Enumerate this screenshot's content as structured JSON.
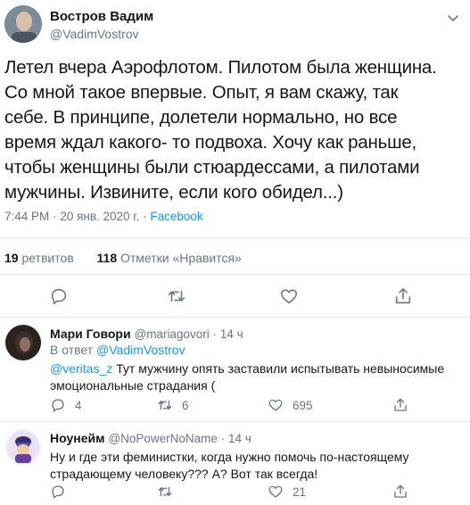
{
  "tweet": {
    "author_name": "Востров Вадим",
    "author_handle": "@VadimVostrov",
    "text": "Летел вчера Аэрофлотом. Пилотом была женщина.\nСо мной такое впервые. Опыт, я вам скажу, так\nсебе. В принципе, долетели нормально, но все\nвремя ждал какого- то подвоха. Хочу как раньше,\nчтобы женщины были стюардессами, а пилотами\nмужчины. Извините, если кого обидел...)",
    "time": "7:44 PM",
    "date": "20 янв. 2020 г.",
    "dot": "·",
    "source": "Facebook",
    "retweets_count": "19",
    "retweets_label": "ретвитов",
    "likes_count": "118",
    "likes_label": "Отметки «Нравится»"
  },
  "replies": [
    {
      "name": "Мари Говори",
      "handle": "@mariagovori",
      "time": "· 14 ч",
      "in_reply_prefix": "В ответ",
      "in_reply_mention": "@VadimVostrov",
      "mention": "@veritas_z",
      "text": " Тут мужчину опять заставили испытывать невыносимые эмоциональные страдания (",
      "reply_count": "4",
      "retweet_count": "6",
      "like_count": "695"
    },
    {
      "name": "Ноунейм",
      "handle": "@NoPowerNoName",
      "time": "· 14 ч",
      "text": "Ну и где эти феминистки, когда нужно помочь по-настоящему страдающему человеку??? А? Вот так всегда!",
      "reply_count": "",
      "retweet_count": "",
      "like_count": "21"
    }
  ],
  "colors": {
    "accent": "#1b95e0",
    "muted": "#657786",
    "separator": "#e6ecf0"
  }
}
